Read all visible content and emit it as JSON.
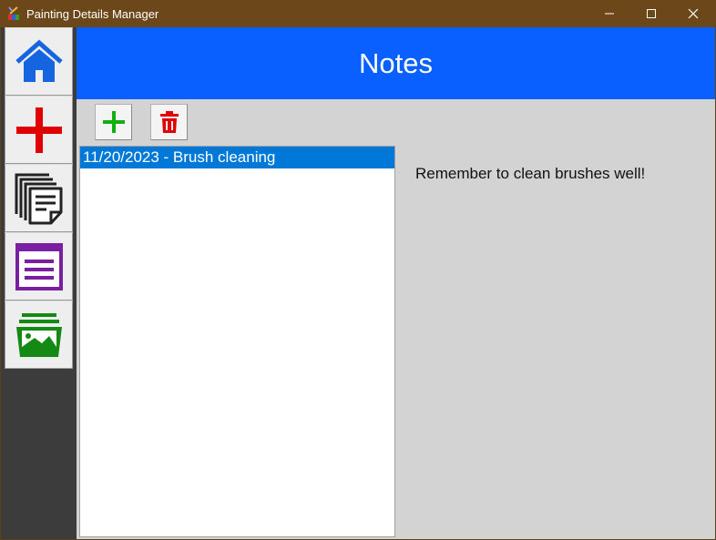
{
  "window": {
    "title": "Painting Details Manager",
    "controls": [
      "minimize-icon",
      "maximize-icon",
      "close-icon"
    ]
  },
  "sidebar": {
    "items": [
      {
        "name": "home",
        "icon": "home-icon",
        "color": "#1565e0"
      },
      {
        "name": "add",
        "icon": "plus-icon",
        "color": "#e00000"
      },
      {
        "name": "notes",
        "icon": "documents-icon",
        "color": "#222222"
      },
      {
        "name": "details",
        "icon": "list-window-icon",
        "color": "#7a1fa2"
      },
      {
        "name": "gallery",
        "icon": "image-stack-icon",
        "color": "#148a14"
      }
    ]
  },
  "header": {
    "title": "Notes",
    "color": "#0a60ff"
  },
  "toolbar": {
    "add_icon": "plus-icon",
    "add_color": "#11b011",
    "delete_icon": "trash-icon",
    "delete_color": "#e00000"
  },
  "notes_list": {
    "items": [
      {
        "label": "11/20/2023 - Brush cleaning",
        "selected": true
      }
    ],
    "selection_color": "#0078d7"
  },
  "note_detail": {
    "text": "Remember to clean brushes well!"
  }
}
